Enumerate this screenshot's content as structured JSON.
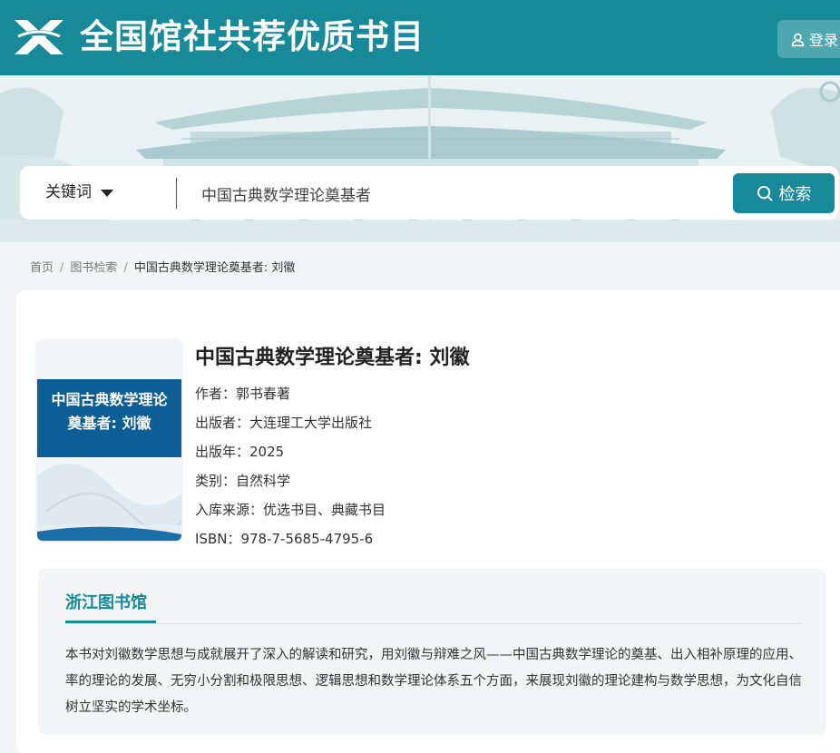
{
  "header": {
    "site_title": "全国馆社共荐优质书目",
    "login_label": "登录",
    "brand_color": "#168a98"
  },
  "search": {
    "field_selector": "关键词",
    "query": "中国古典数学理论奠基者",
    "button_label": "检索"
  },
  "breadcrumb": {
    "items": [
      "首页",
      "图书检索"
    ],
    "current": "中国古典数学理论奠基者: 刘徽"
  },
  "book": {
    "cover_title_line1": "中国古典数学理论",
    "cover_title_line2": "奠基者: 刘徽",
    "title": "中国古典数学理论奠基者: 刘徽",
    "author": "作者：郭书春著",
    "publisher": "出版者：大连理工大学出版社",
    "year": "出版年：2025",
    "category": "类别：自然科学",
    "source": "入库来源：优选书目、典藏书目",
    "isbn": "ISBN：978-7-5685-4795-6"
  },
  "library": {
    "tab_label": "浙江图书馆",
    "description": "本书对刘徽数学思想与成就展开了深入的解读和研究，用刘徽与辩难之风——中国古典数学理论的奠基、出入相补原理的应用、率的理论的发展、无穷小分割和极限思想、逻辑思想和数学理论体系五个方面，来展现刘徽的理论建构与数学思想，为文化自信树立坚实的学术坐标。"
  },
  "icons": {
    "logo": "ribbon-logo-icon",
    "login": "user-icon",
    "search": "search-icon",
    "dropdown": "caret-down-icon"
  }
}
